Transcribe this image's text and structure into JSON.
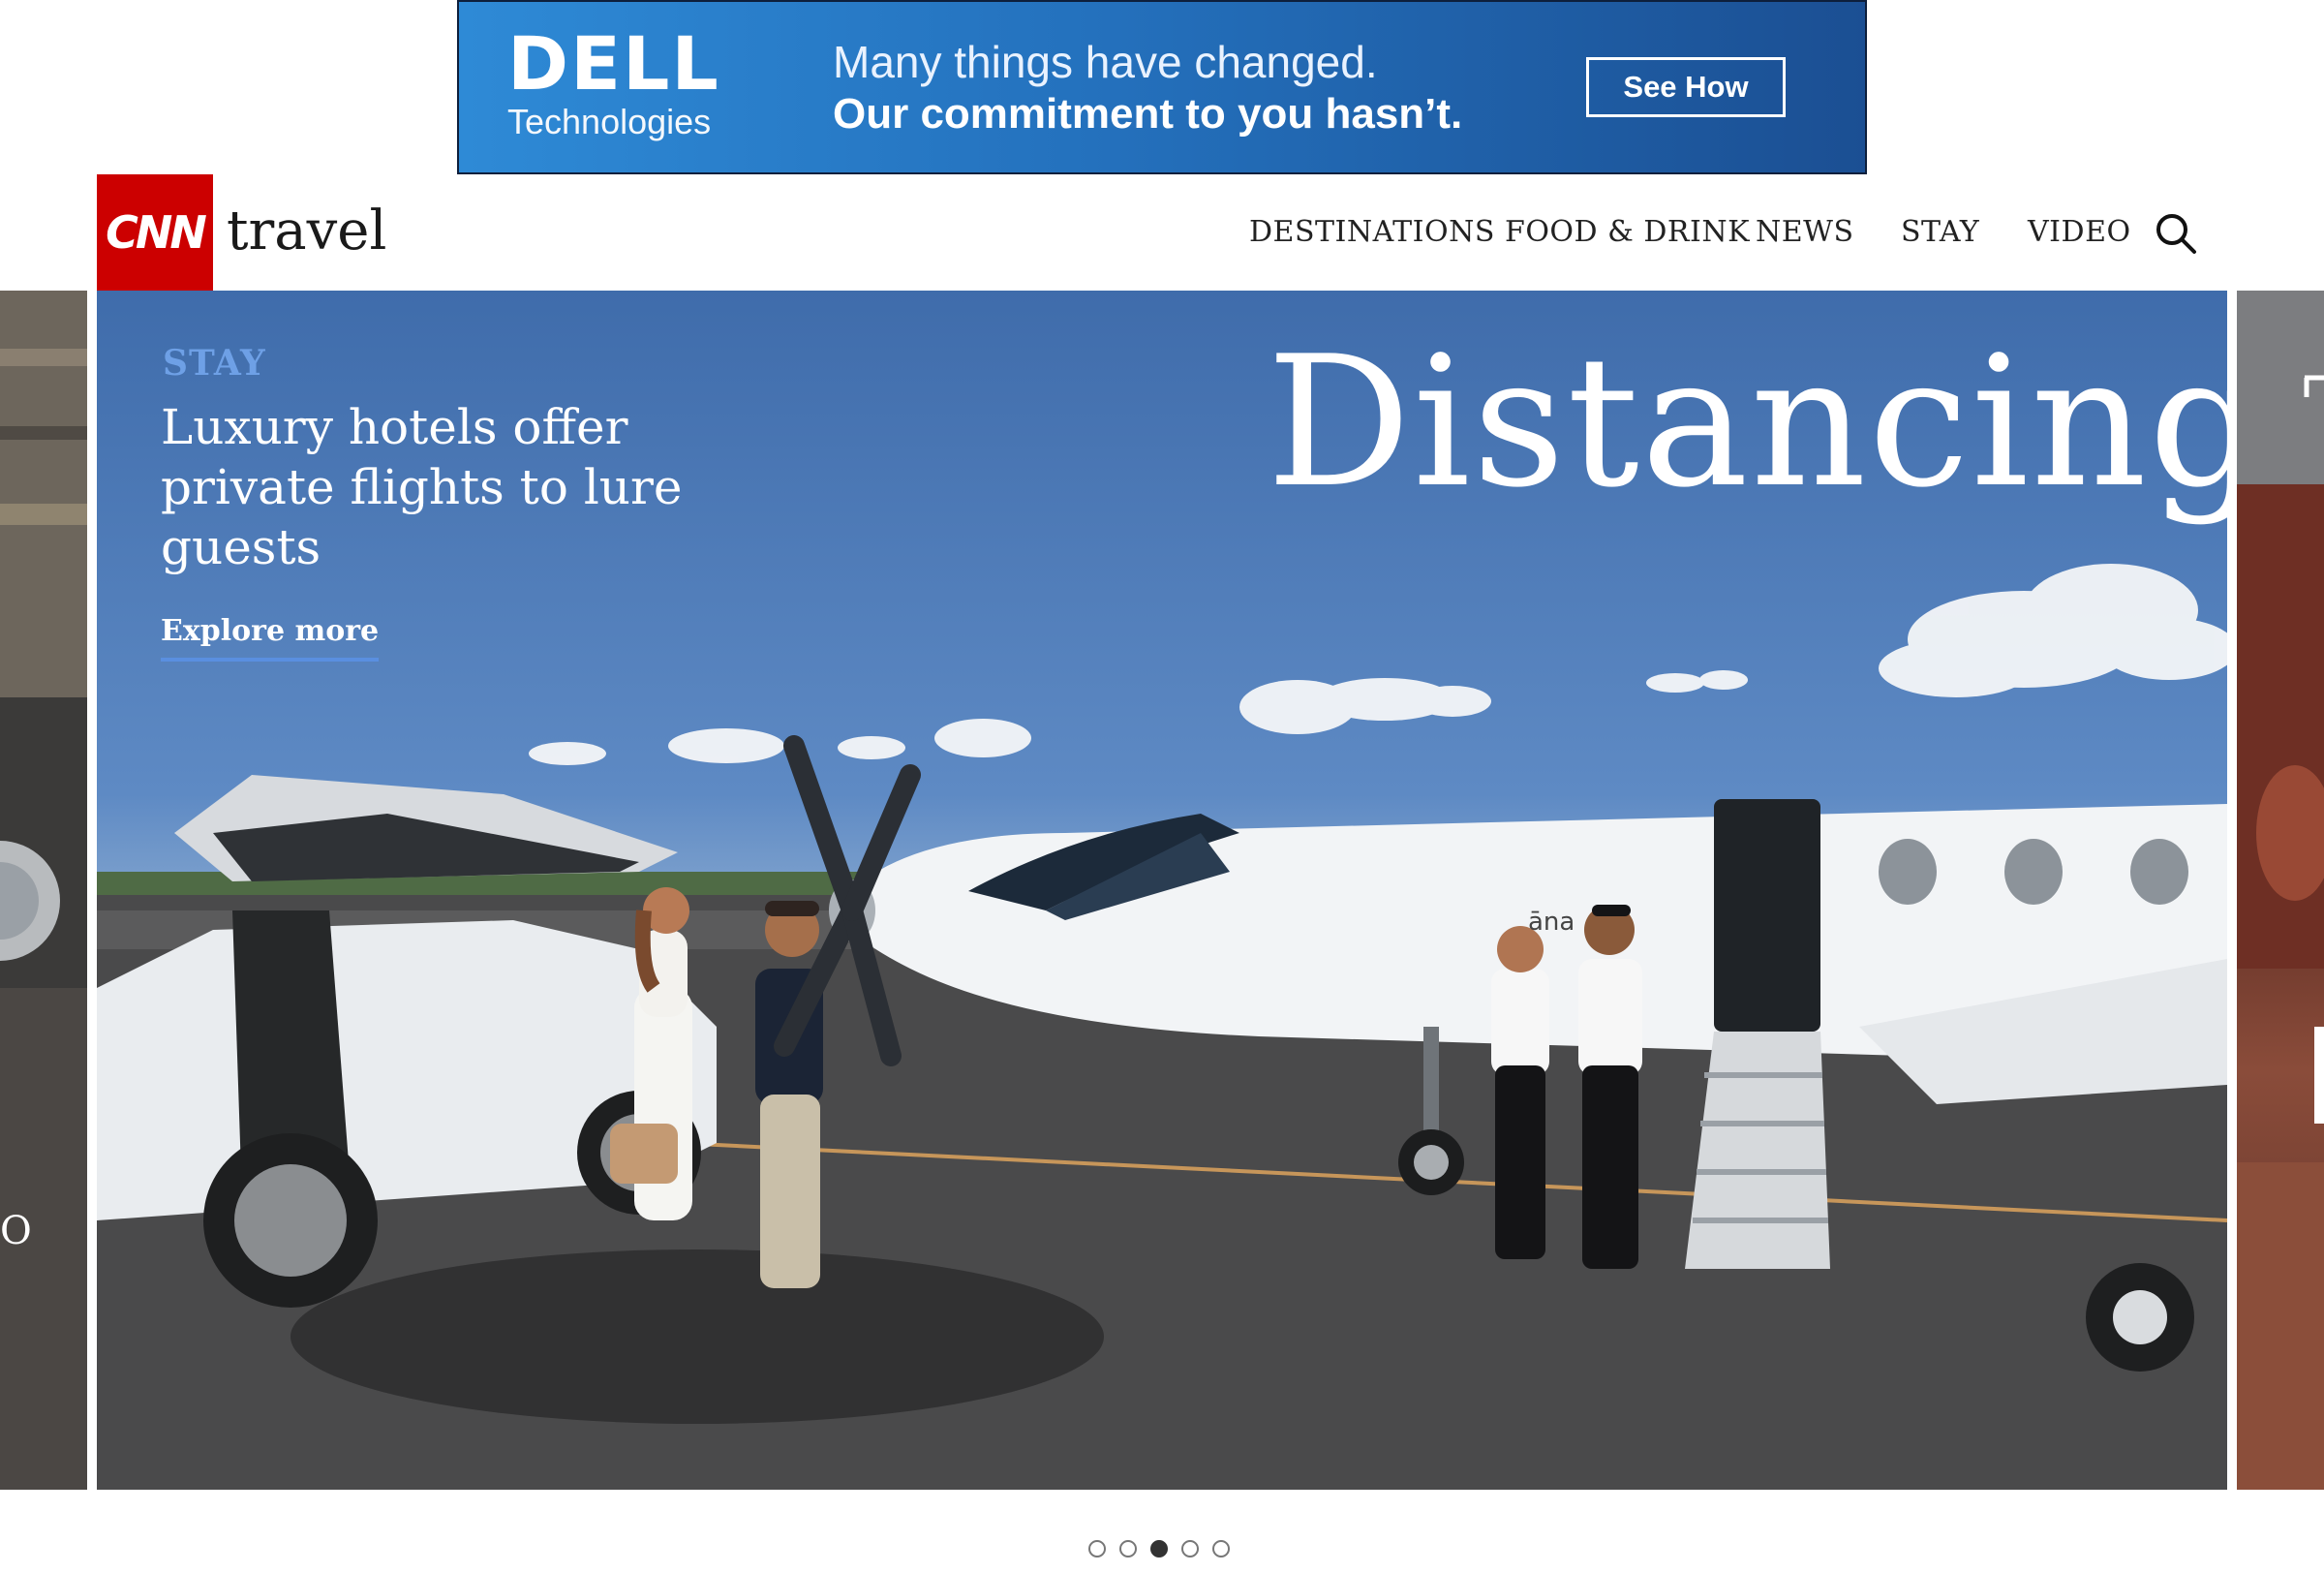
{
  "ad": {
    "brand": "DELL",
    "brand_sub": "Technologies",
    "line1": "Many things have changed.",
    "line2": "Our commitment to you hasn’t.",
    "cta": "See How"
  },
  "header": {
    "logo_text": "CNN",
    "section_name": "travel",
    "nav": [
      "DESTINATIONS",
      "FOOD & DRINK",
      "NEWS",
      "STAY",
      "VIDEO"
    ],
    "search_icon": "search-icon"
  },
  "hero": {
    "kicker": "STAY",
    "headline": "Luxury hotels offer private flights to lure guests",
    "cta": "Explore more",
    "title": "Distancing",
    "aircraft_text": "āna"
  },
  "left_peek": {
    "partial_text": "O"
  },
  "carousel": {
    "total": 5,
    "active_index": 2
  },
  "colors": {
    "cnn_red": "#cc0000",
    "ad_blue": "#2471bd",
    "kicker_blue": "#6ea0e6",
    "underline_blue": "#5a8fe0"
  }
}
